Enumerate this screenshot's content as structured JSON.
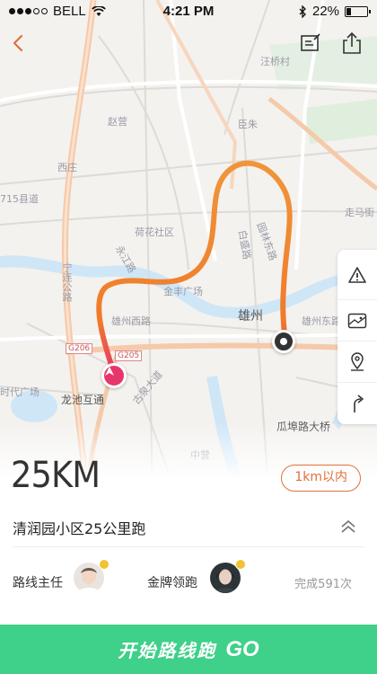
{
  "status_bar": {
    "carrier": "BELL",
    "time": "4:21 PM",
    "battery": "22%",
    "battery_level": 0.22,
    "icons": [
      "signal-dots",
      "wifi-icon",
      "bluetooth-icon",
      "battery-icon"
    ]
  },
  "toolbar": {
    "icons": [
      "back-arrow-icon",
      "edit-note-icon",
      "share-icon"
    ]
  },
  "map": {
    "labels": {
      "zhaoying": "赵营",
      "xizhuang": "西庄",
      "wanghuai": "汪桥村",
      "zhangzhu": "臣朱",
      "county_road": "715县道",
      "hehua": "荷花社区",
      "yongjiang": "永江路",
      "yuanlin": "园林东路",
      "baisheng": "白盛路",
      "jinfeng": "金丰广场",
      "xiongzhou_west": "雄州西路",
      "xiongzhou": "雄州",
      "xiongzhou_east": "雄州东路",
      "ninglian": "宁连公路",
      "g206": "G206",
      "g205": "G205",
      "longchi": "龙池互通",
      "shidai": "时代广场",
      "gulei": "古泉大道",
      "zoumao": "走马街",
      "guabu": "瓜埠路大桥",
      "zhongying": "中营"
    },
    "tools": [
      "warning-icon",
      "map-layer-icon",
      "location-pin-icon",
      "navigate-arrow-icon"
    ]
  },
  "route": {
    "distance": "25KM",
    "range_badge": "1km以内",
    "title": "清润园小区25公里跑",
    "leader_label": "路线主任",
    "gold_label": "金牌领跑",
    "completed": "完成591次"
  },
  "start": {
    "label": "开始路线跑",
    "go": "GO"
  },
  "colors": {
    "accent": "#e0703a",
    "start_bar": "#3fd089",
    "route_start": "#e8356c",
    "route_end": "#f0953a"
  }
}
